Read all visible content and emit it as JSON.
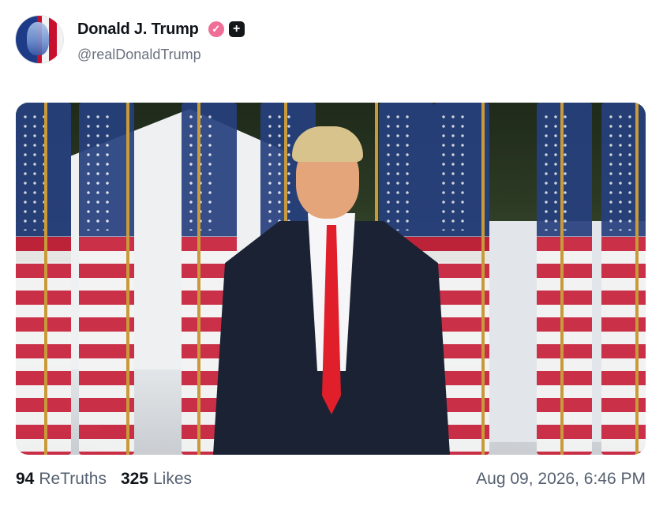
{
  "post": {
    "author": {
      "name": "Donald J. Trump",
      "handle": "@realDonaldTrump",
      "verified_icon": "verified-badge",
      "extra_icon": "plus-badge"
    },
    "media": {
      "type": "image",
      "icon": "photo"
    },
    "stats": {
      "retruths_count": "94",
      "retruths_label": "ReTruths",
      "likes_count": "325",
      "likes_label": "Likes"
    },
    "timestamp": "Aug 09, 2026, 6:46 PM"
  },
  "colors": {
    "text": "#0f1419",
    "muted": "#6b7280",
    "verified": "#ef6f97",
    "accent": "#14171a"
  }
}
